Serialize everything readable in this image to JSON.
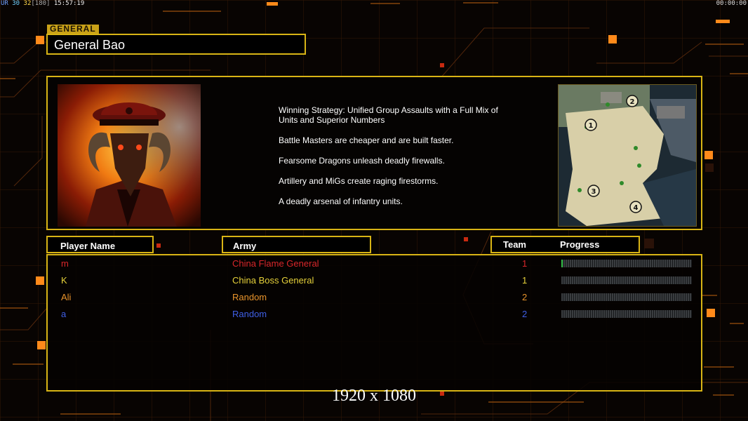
{
  "hud": {
    "stats_prefix": "UR",
    "stat_a": "30",
    "stat_b": "32",
    "stat_c": "[180]",
    "clock": "15:57:19",
    "timer": "00:00:00"
  },
  "general": {
    "category_label": "GENERAL",
    "name": "General Bao",
    "portrait_icon": "general-portrait",
    "description": [
      "Winning Strategy: Unified Group Assaults with a Full Mix of Units and Superior Numbers",
      "Battle Masters are cheaper and are built faster.",
      "Fearsome Dragons unleash deadly firewalls.",
      "Artillery and MiGs create raging firestorms.",
      "A deadly arsenal of infantry units."
    ]
  },
  "map": {
    "icon": "map-preview",
    "start_positions": [
      "1",
      "2",
      "3",
      "4"
    ]
  },
  "table": {
    "headers": {
      "player": "Player Name",
      "army": "Army",
      "team": "Team",
      "progress": "Progress"
    },
    "rows": [
      {
        "name": "m",
        "army": "China Flame General",
        "team": "1",
        "color": "#d8262a",
        "progress": 0.01
      },
      {
        "name": "K",
        "army": "China Boss General",
        "team": "1",
        "color": "#e6d13a",
        "progress": 0.0
      },
      {
        "name": "Ali",
        "army": "Random",
        "team": "2",
        "color": "#e8932c",
        "progress": 0.0
      },
      {
        "name": "a",
        "army": "Random",
        "team": "2",
        "color": "#3f5fe6",
        "progress": 0.0
      }
    ]
  },
  "footer": {
    "resolution": "1920 x 1080"
  },
  "colors": {
    "border": "#d8b415",
    "accent": "#ff8a1a",
    "progress_fill": "#35c24a"
  }
}
